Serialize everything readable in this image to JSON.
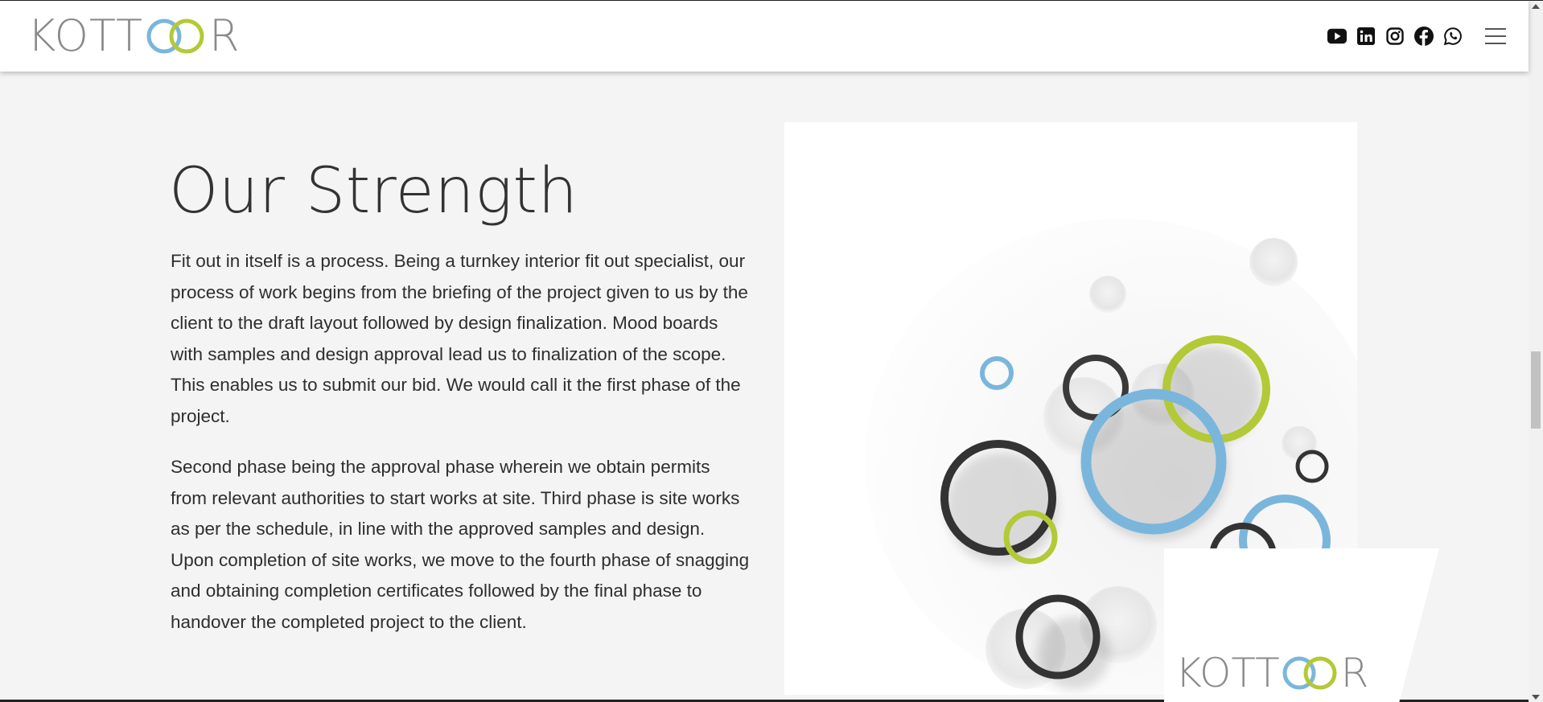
{
  "header": {
    "logo_text_left": "KOTT",
    "logo_text_right": "R",
    "social_icons": [
      "youtube-icon",
      "linkedin-icon",
      "instagram-icon",
      "facebook-icon",
      "whatsapp-icon"
    ],
    "menu_icon": "hamburger-menu-icon"
  },
  "main": {
    "title": "Our Strength",
    "paragraph_1": "Fit out in itself is a process. Being a turnkey interior fit out specialist, our process of work begins from the briefing of the project given to us by the client to the draft layout followed by design finalization. Mood boards with samples and design approval lead us to finalization of the scope. This enables us to submit our bid. We would call it the first phase of the project.",
    "paragraph_2": "Second phase being the approval phase wherein we obtain permits from relevant authorities to start works at site. Third phase is site works as per the schedule, in line with the approved samples and design. Upon completion of site works, we move to the fourth phase of snagging and obtaining completion certificates followed by the final phase to handover the completed project to the client."
  },
  "image_logo": {
    "text_left": "KOTT",
    "text_right": "R"
  },
  "colors": {
    "ring_blue": "#7ab6dc",
    "ring_green": "#b3c936",
    "ring_dark": "#333333",
    "logo_gray": "#8a8a8a"
  }
}
